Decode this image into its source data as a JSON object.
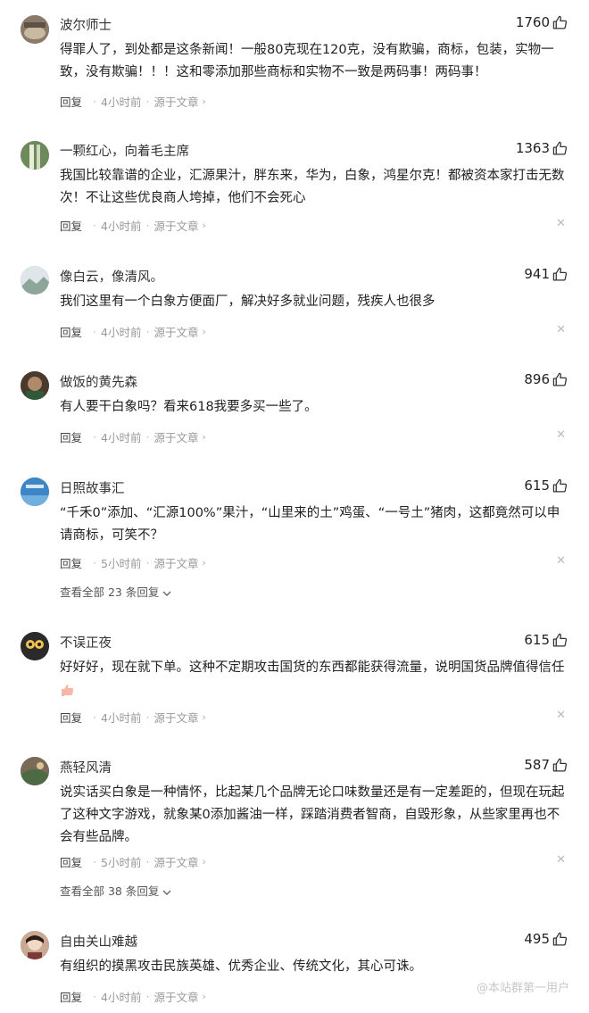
{
  "labels": {
    "reply": "回复",
    "dot": "·",
    "from_article": "源于文章",
    "chevron": "›",
    "close": "✕"
  },
  "comments": [
    {
      "user": "波尔师士",
      "likes": "1760",
      "text": "得罪人了，到处都是这条新闻！一般80克现在120克，没有欺骗，商标，包装，实物一致，没有欺骗！！！这和零添加那些商标和实物不一致是两码事！两码事！",
      "time": "4小时前",
      "avatar_color": "#8a7a6a"
    },
    {
      "user": "一颗红心，向着毛主席",
      "likes": "1363",
      "text": "我国比较靠谱的企业，汇源果汁，胖东来，华为，白象，鸿星尔克！都被资本家打击无数次！不让这些优良商人垮掉，他们不会死心",
      "time": "4小时前",
      "avatar_color": "#6c8a5a"
    },
    {
      "user": "像白云，像清风。",
      "likes": "941",
      "text": "我们这里有一个白象方便面厂，解决好多就业问题，残疾人也很多",
      "time": "4小时前",
      "avatar_color": "#9fb3a8"
    },
    {
      "user": "做饭的黄先森",
      "likes": "896",
      "text": "有人要干白象吗？看来618我要多买一些了。",
      "time": "4小时前",
      "avatar_color": "#5a4a3a"
    },
    {
      "user": "日照故事汇",
      "likes": "615",
      "text": "“千禾0”添加、“汇源100%”果汁，“山里来的土”鸡蛋、“一号土”猪肉，这都竟然可以申请商标，可笑不？",
      "time": "5小时前",
      "more": "查看全部 23 条回复",
      "avatar_color": "#3c86c8"
    },
    {
      "user": "不误正夜",
      "likes": "615",
      "text": "好好好，现在就下单。这种不定期攻击国货的东西都能获得流量，说明国货品牌值得信任",
      "time": "4小时前",
      "emoji": "thumbs-up-emoji",
      "avatar_color": "#2a2a2a"
    },
    {
      "user": "燕轻风清",
      "likes": "587",
      "text": "说实话买白象是一种情怀，比起某几个品牌无论口味数量还是有一定差距的，但现在玩起了这种文字游戏，就象某0添加酱油一样，踩踏消费者智商，自毁形象，从些家里再也不会有些品牌。",
      "time": "5小时前",
      "more": "查看全部 38 条回复",
      "avatar_color": "#7a6a58"
    },
    {
      "user": "自由关山难越",
      "likes": "495",
      "text": "有组织的摸黑攻击民族英雄、优秀企业、传统文化，其心可诛。",
      "time": "4小时前",
      "avatar_color": "#b89a86"
    }
  ],
  "watermark": "@本站群第一用户"
}
